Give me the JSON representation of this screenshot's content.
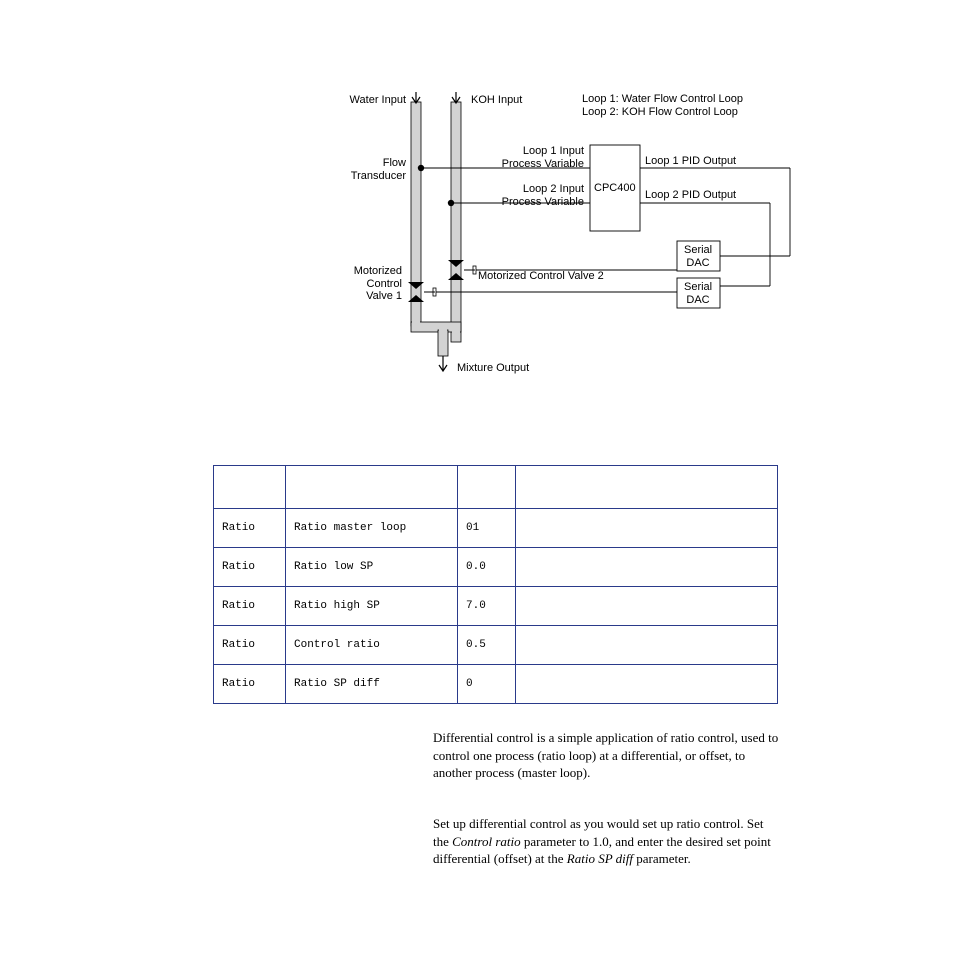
{
  "diagram": {
    "water_input": "Water Input",
    "koh_input": "KOH Input",
    "flow_transducer": "Flow\nTransducer",
    "loop1_desc": "Loop 1: Water Flow Control Loop",
    "loop2_desc": "Loop 2: KOH Flow Control Loop",
    "loop1_input": "Loop 1 Input\nProcess Variable",
    "loop2_input": "Loop 2 Input\nProcess Variable",
    "cpc400": "CPC400",
    "loop1_output": "Loop 1 PID Output",
    "loop2_output": "Loop 2 PID Output",
    "serial_dac": "Serial\nDAC",
    "mcv2": "Motorized Control Valve 2",
    "mcv1": "Motorized\nControl\nValve 1",
    "mixture_output": "Mixture Output"
  },
  "table": {
    "rows": [
      {
        "category": "Ratio",
        "param": "Ratio master loop",
        "value": "01",
        "note": ""
      },
      {
        "category": "Ratio",
        "param": "Ratio low SP",
        "value": "0.0",
        "note": ""
      },
      {
        "category": "Ratio",
        "param": "Ratio high SP",
        "value": "7.0",
        "note": ""
      },
      {
        "category": "Ratio",
        "param": "Control ratio",
        "value": "0.5",
        "note": ""
      },
      {
        "category": "Ratio",
        "param": "Ratio SP diff",
        "value": "0",
        "note": ""
      }
    ]
  },
  "text": {
    "para1": "Differential control is a simple application of ratio control, used to control one process (ratio loop) at a differential, or offset, to another process (master loop).",
    "para2a": "Set up differential control as you would set up ratio control. Set the ",
    "para2_i1": "Control ratio",
    "para2b": " parameter to 1.0, and enter the desired set point differential (offset) at the ",
    "para2_i2": "Ratio SP diff",
    "para2c": " parameter."
  }
}
